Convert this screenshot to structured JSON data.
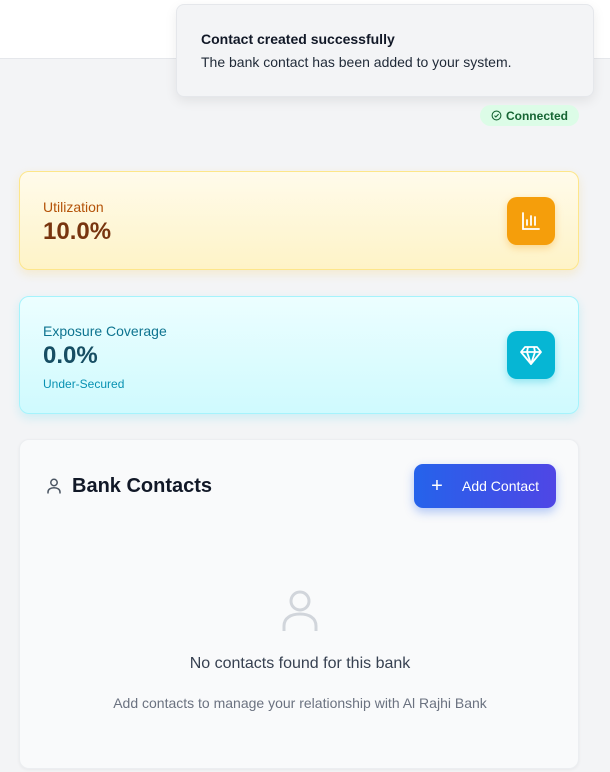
{
  "toast": {
    "title": "Contact created successfully",
    "description": "The bank contact has been added to your system."
  },
  "status": {
    "label": "Connected",
    "icon": "check-circle-icon"
  },
  "metrics": {
    "utilization": {
      "label": "Utilization",
      "value": "10.0%",
      "icon": "bar-chart-icon",
      "accent": "#f59e0b"
    },
    "exposure": {
      "label": "Exposure Coverage",
      "value": "0.0%",
      "subtext": "Under-Secured",
      "icon": "diamond-icon",
      "accent": "#06b6d4"
    }
  },
  "contacts": {
    "title": "Bank Contacts",
    "header_icon": "user-icon",
    "add_button_label": "Add Contact",
    "add_button_icon": "plus-icon",
    "empty_icon": "user-icon",
    "empty_title": "No contacts found for this bank",
    "empty_description": "Add contacts to manage your relationship with Al Rajhi Bank"
  }
}
